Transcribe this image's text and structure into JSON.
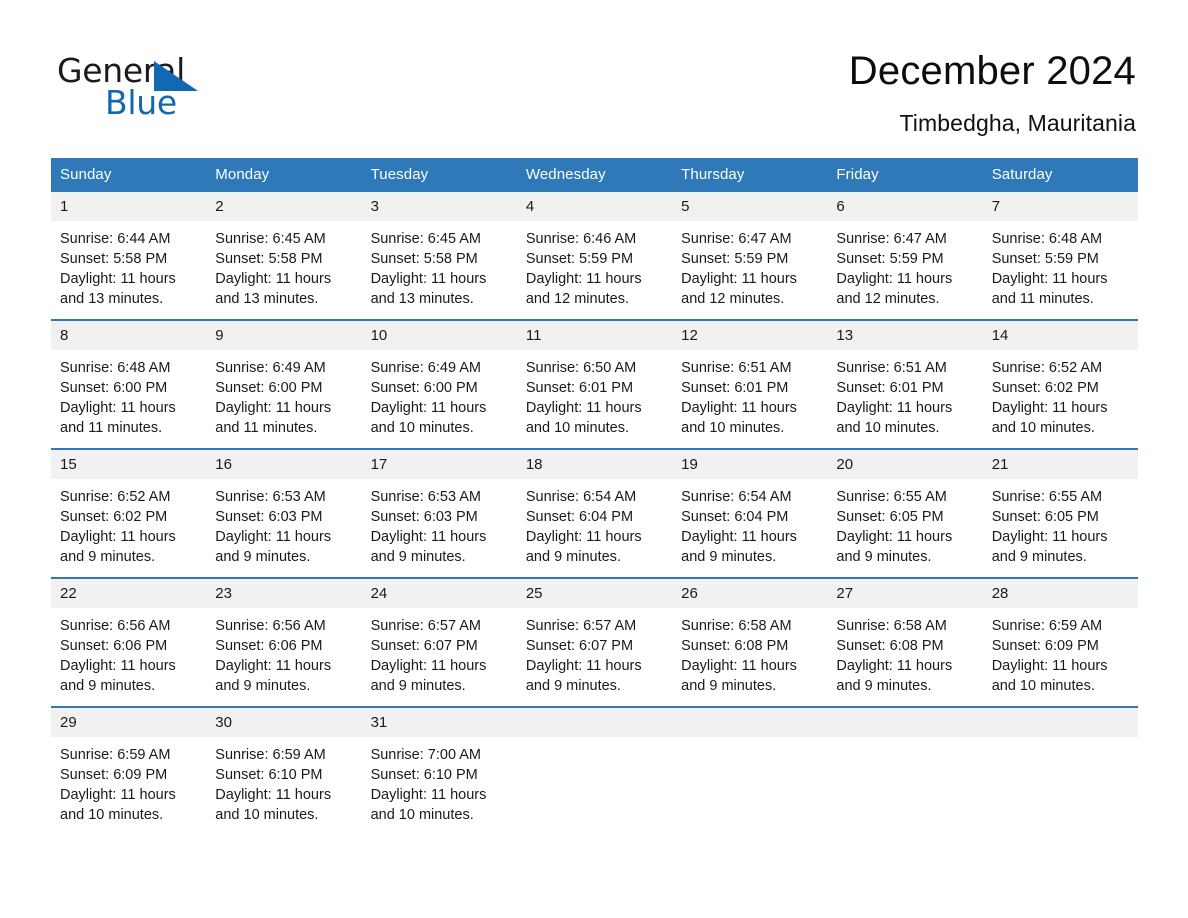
{
  "logo": {
    "word1": "General",
    "word2": "Blue",
    "triangle_color": "#1268b3",
    "icon": "triangle-icon"
  },
  "header": {
    "month_title": "December 2024",
    "location": "Timbedgha, Mauritania"
  },
  "theme": {
    "header_blue": "#2f79b9",
    "row_divider_blue": "#2f79b9",
    "daynum_band": "#f1f1f1",
    "text": "#1a1a1a"
  },
  "calendar": {
    "weekday_headers": [
      "Sunday",
      "Monday",
      "Tuesday",
      "Wednesday",
      "Thursday",
      "Friday",
      "Saturday"
    ],
    "weeks": [
      [
        {
          "day": "1",
          "sunrise": "Sunrise: 6:44 AM",
          "sunset": "Sunset: 5:58 PM",
          "daylight": "Daylight: 11 hours and 13 minutes."
        },
        {
          "day": "2",
          "sunrise": "Sunrise: 6:45 AM",
          "sunset": "Sunset: 5:58 PM",
          "daylight": "Daylight: 11 hours and 13 minutes."
        },
        {
          "day": "3",
          "sunrise": "Sunrise: 6:45 AM",
          "sunset": "Sunset: 5:58 PM",
          "daylight": "Daylight: 11 hours and 13 minutes."
        },
        {
          "day": "4",
          "sunrise": "Sunrise: 6:46 AM",
          "sunset": "Sunset: 5:59 PM",
          "daylight": "Daylight: 11 hours and 12 minutes."
        },
        {
          "day": "5",
          "sunrise": "Sunrise: 6:47 AM",
          "sunset": "Sunset: 5:59 PM",
          "daylight": "Daylight: 11 hours and 12 minutes."
        },
        {
          "day": "6",
          "sunrise": "Sunrise: 6:47 AM",
          "sunset": "Sunset: 5:59 PM",
          "daylight": "Daylight: 11 hours and 12 minutes."
        },
        {
          "day": "7",
          "sunrise": "Sunrise: 6:48 AM",
          "sunset": "Sunset: 5:59 PM",
          "daylight": "Daylight: 11 hours and 11 minutes."
        }
      ],
      [
        {
          "day": "8",
          "sunrise": "Sunrise: 6:48 AM",
          "sunset": "Sunset: 6:00 PM",
          "daylight": "Daylight: 11 hours and 11 minutes."
        },
        {
          "day": "9",
          "sunrise": "Sunrise: 6:49 AM",
          "sunset": "Sunset: 6:00 PM",
          "daylight": "Daylight: 11 hours and 11 minutes."
        },
        {
          "day": "10",
          "sunrise": "Sunrise: 6:49 AM",
          "sunset": "Sunset: 6:00 PM",
          "daylight": "Daylight: 11 hours and 10 minutes."
        },
        {
          "day": "11",
          "sunrise": "Sunrise: 6:50 AM",
          "sunset": "Sunset: 6:01 PM",
          "daylight": "Daylight: 11 hours and 10 minutes."
        },
        {
          "day": "12",
          "sunrise": "Sunrise: 6:51 AM",
          "sunset": "Sunset: 6:01 PM",
          "daylight": "Daylight: 11 hours and 10 minutes."
        },
        {
          "day": "13",
          "sunrise": "Sunrise: 6:51 AM",
          "sunset": "Sunset: 6:01 PM",
          "daylight": "Daylight: 11 hours and 10 minutes."
        },
        {
          "day": "14",
          "sunrise": "Sunrise: 6:52 AM",
          "sunset": "Sunset: 6:02 PM",
          "daylight": "Daylight: 11 hours and 10 minutes."
        }
      ],
      [
        {
          "day": "15",
          "sunrise": "Sunrise: 6:52 AM",
          "sunset": "Sunset: 6:02 PM",
          "daylight": "Daylight: 11 hours and 9 minutes."
        },
        {
          "day": "16",
          "sunrise": "Sunrise: 6:53 AM",
          "sunset": "Sunset: 6:03 PM",
          "daylight": "Daylight: 11 hours and 9 minutes."
        },
        {
          "day": "17",
          "sunrise": "Sunrise: 6:53 AM",
          "sunset": "Sunset: 6:03 PM",
          "daylight": "Daylight: 11 hours and 9 minutes."
        },
        {
          "day": "18",
          "sunrise": "Sunrise: 6:54 AM",
          "sunset": "Sunset: 6:04 PM",
          "daylight": "Daylight: 11 hours and 9 minutes."
        },
        {
          "day": "19",
          "sunrise": "Sunrise: 6:54 AM",
          "sunset": "Sunset: 6:04 PM",
          "daylight": "Daylight: 11 hours and 9 minutes."
        },
        {
          "day": "20",
          "sunrise": "Sunrise: 6:55 AM",
          "sunset": "Sunset: 6:05 PM",
          "daylight": "Daylight: 11 hours and 9 minutes."
        },
        {
          "day": "21",
          "sunrise": "Sunrise: 6:55 AM",
          "sunset": "Sunset: 6:05 PM",
          "daylight": "Daylight: 11 hours and 9 minutes."
        }
      ],
      [
        {
          "day": "22",
          "sunrise": "Sunrise: 6:56 AM",
          "sunset": "Sunset: 6:06 PM",
          "daylight": "Daylight: 11 hours and 9 minutes."
        },
        {
          "day": "23",
          "sunrise": "Sunrise: 6:56 AM",
          "sunset": "Sunset: 6:06 PM",
          "daylight": "Daylight: 11 hours and 9 minutes."
        },
        {
          "day": "24",
          "sunrise": "Sunrise: 6:57 AM",
          "sunset": "Sunset: 6:07 PM",
          "daylight": "Daylight: 11 hours and 9 minutes."
        },
        {
          "day": "25",
          "sunrise": "Sunrise: 6:57 AM",
          "sunset": "Sunset: 6:07 PM",
          "daylight": "Daylight: 11 hours and 9 minutes."
        },
        {
          "day": "26",
          "sunrise": "Sunrise: 6:58 AM",
          "sunset": "Sunset: 6:08 PM",
          "daylight": "Daylight: 11 hours and 9 minutes."
        },
        {
          "day": "27",
          "sunrise": "Sunrise: 6:58 AM",
          "sunset": "Sunset: 6:08 PM",
          "daylight": "Daylight: 11 hours and 9 minutes."
        },
        {
          "day": "28",
          "sunrise": "Sunrise: 6:59 AM",
          "sunset": "Sunset: 6:09 PM",
          "daylight": "Daylight: 11 hours and 10 minutes."
        }
      ],
      [
        {
          "day": "29",
          "sunrise": "Sunrise: 6:59 AM",
          "sunset": "Sunset: 6:09 PM",
          "daylight": "Daylight: 11 hours and 10 minutes."
        },
        {
          "day": "30",
          "sunrise": "Sunrise: 6:59 AM",
          "sunset": "Sunset: 6:10 PM",
          "daylight": "Daylight: 11 hours and 10 minutes."
        },
        {
          "day": "31",
          "sunrise": "Sunrise: 7:00 AM",
          "sunset": "Sunset: 6:10 PM",
          "daylight": "Daylight: 11 hours and 10 minutes."
        },
        {
          "day": "",
          "sunrise": "",
          "sunset": "",
          "daylight": ""
        },
        {
          "day": "",
          "sunrise": "",
          "sunset": "",
          "daylight": ""
        },
        {
          "day": "",
          "sunrise": "",
          "sunset": "",
          "daylight": ""
        },
        {
          "day": "",
          "sunrise": "",
          "sunset": "",
          "daylight": ""
        }
      ]
    ]
  }
}
